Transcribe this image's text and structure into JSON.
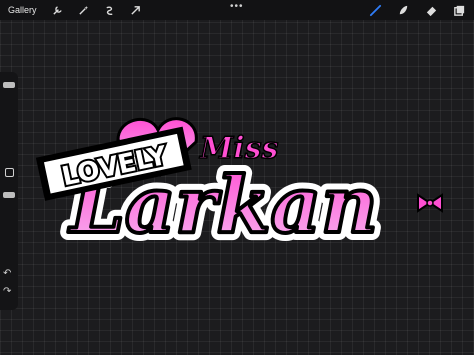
{
  "topbar": {
    "gallery_label": "Gallery",
    "left_tools": [
      "wrench-icon",
      "magic-wand-icon",
      "selection-icon",
      "transform-arrow-icon"
    ],
    "more_label": "•••",
    "right_tools": [
      "brush-icon",
      "smudge-icon",
      "eraser-icon",
      "layers-icon"
    ],
    "active_color": "#2f7cf6"
  },
  "artwork": {
    "word_small": "Miss",
    "word_main": "Larkan",
    "tag_text": "LOVELY",
    "colors": {
      "pink_top": "#ff4fd3",
      "pink_bottom": "#f7b3f0",
      "outline": "#000000",
      "tag_fill": "#ffffff"
    }
  },
  "sidebar": {
    "undo_icon": "undo-icon",
    "redo_icon": "redo-icon"
  }
}
